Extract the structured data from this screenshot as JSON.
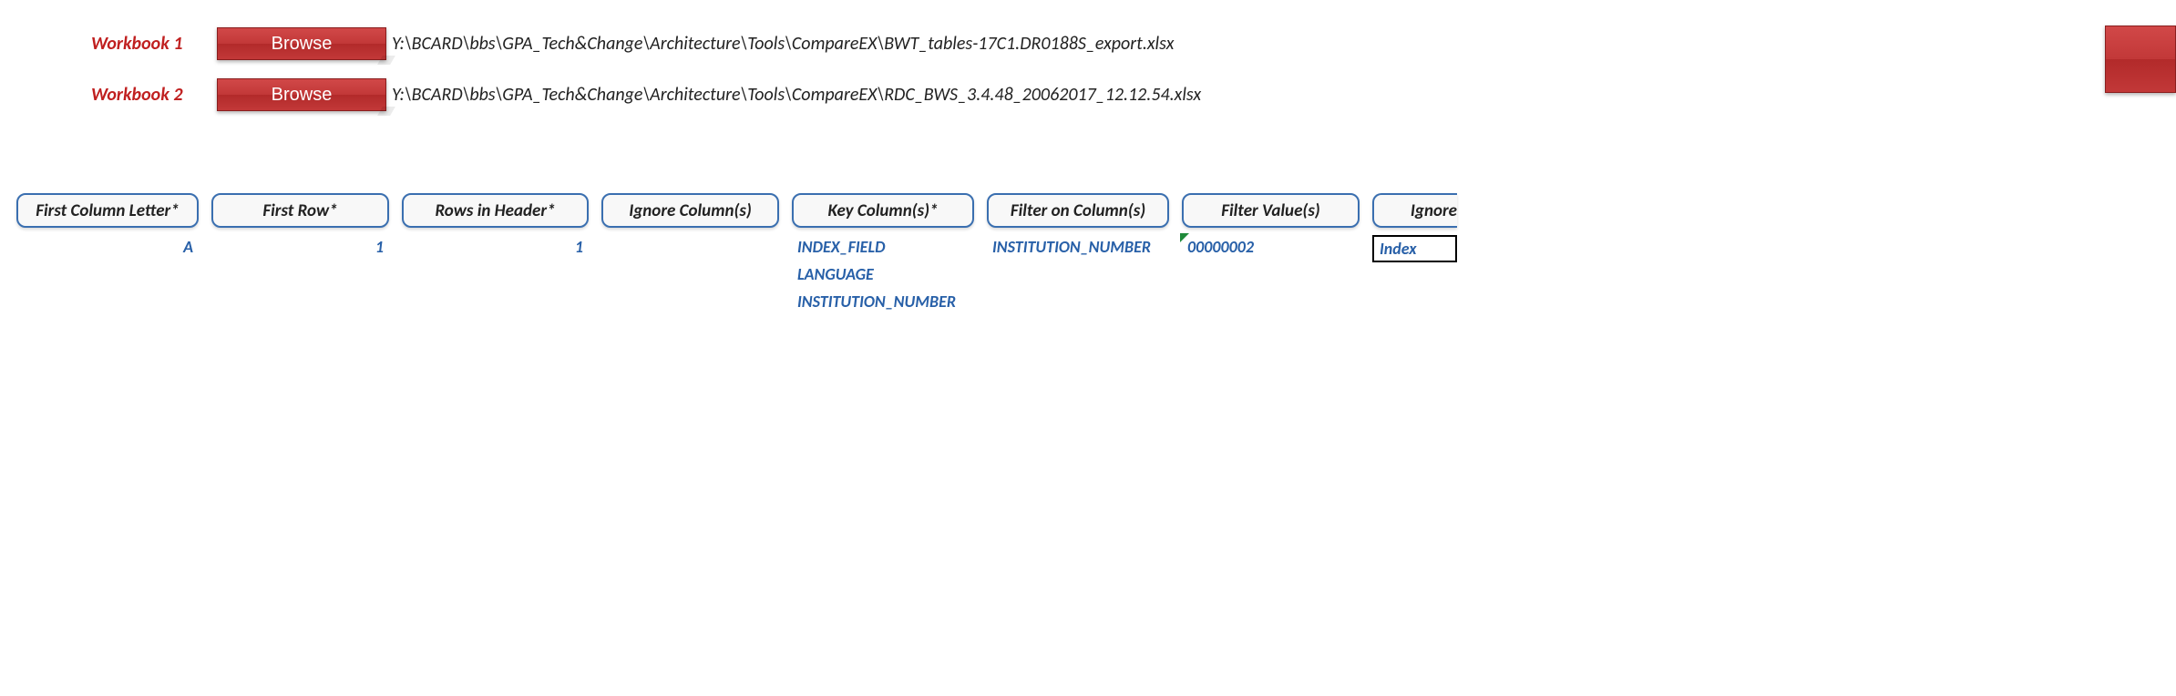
{
  "workbooks": [
    {
      "label": "Workbook 1",
      "button": "Browse",
      "path": "Y:\\BCARD\\bbs\\GPA_Tech&Change\\Architecture\\Tools\\CompareEX\\BWT_tables-17C1.DR0188S_export.xlsx"
    },
    {
      "label": "Workbook 2",
      "button": "Browse",
      "path": "Y:\\BCARD\\bbs\\GPA_Tech&Change\\Architecture\\Tools\\CompareEX\\RDC_BWS_3.4.48_20062017_12.12.54.xlsx"
    }
  ],
  "columns": {
    "first_column_letter": {
      "label": "First Column Letter*",
      "value": "A"
    },
    "first_row": {
      "label": "First Row*",
      "value": "1"
    },
    "rows_in_header": {
      "label": "Rows in Header*",
      "value": "1"
    },
    "ignore_columns": {
      "label": "Ignore Column(s)",
      "value": ""
    },
    "key_columns": {
      "label": "Key Column(s)*",
      "values": [
        "INDEX_FIELD",
        "LANGUAGE",
        "INSTITUTION_NUMBER"
      ]
    },
    "filter_on_columns": {
      "label": "Filter on Column(s)",
      "value": "INSTITUTION_NUMBER"
    },
    "filter_values": {
      "label": "Filter Value(s)",
      "value": "00000002"
    },
    "ignore_tail": {
      "label": "Ignore",
      "value": "Index"
    }
  }
}
